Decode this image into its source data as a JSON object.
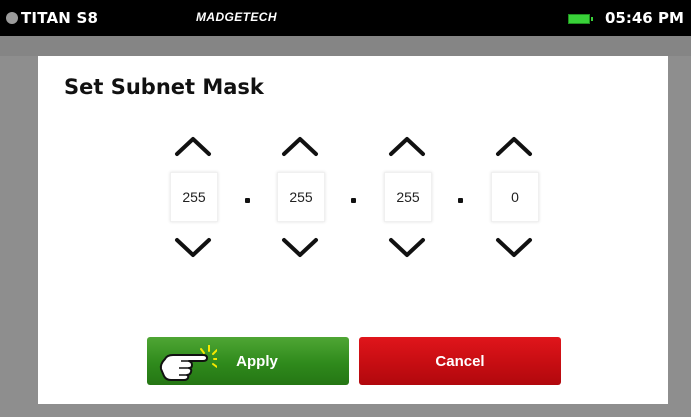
{
  "status_bar": {
    "device_name": "TITAN S8",
    "brand": "MADGETECH",
    "time": "05:46 PM",
    "battery_icon": "battery-full-icon",
    "battery_color": "#39d139"
  },
  "dialog": {
    "title": "Set Subnet Mask",
    "octets": [
      {
        "value": "255"
      },
      {
        "value": "255"
      },
      {
        "value": "255"
      },
      {
        "value": "0"
      }
    ],
    "separator": ".",
    "apply_label": "Apply",
    "cancel_label": "Cancel",
    "apply_color": "#2f8a1c",
    "cancel_color": "#c60d12",
    "pointer_icon": "hand-tap-icon"
  }
}
